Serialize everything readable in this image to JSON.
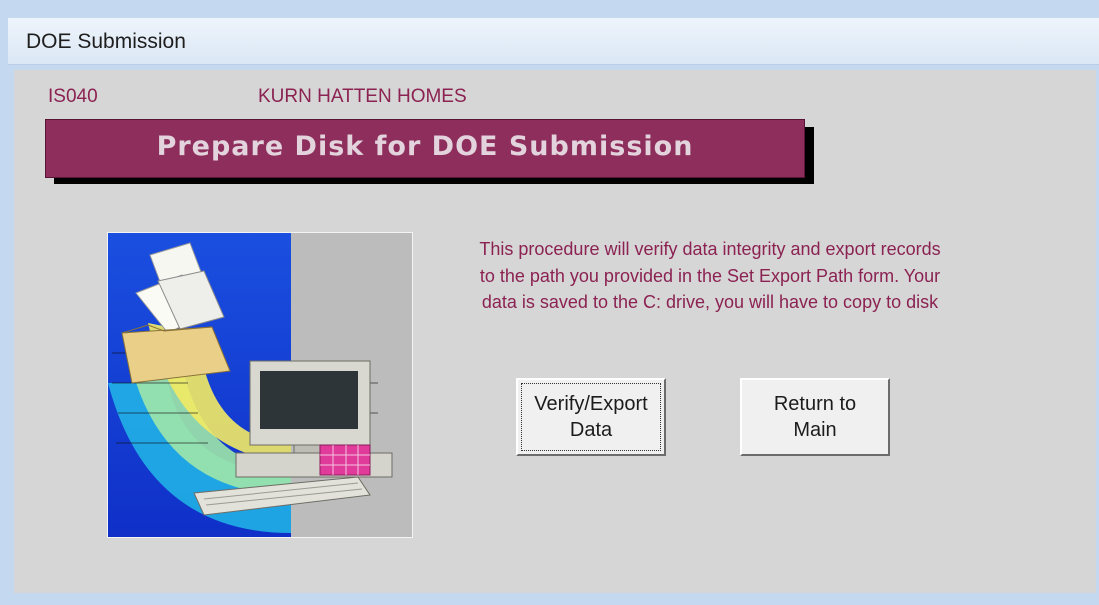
{
  "window": {
    "title": "DOE Submission"
  },
  "form": {
    "form_id": "IS040",
    "company_name": "KURN HATTEN HOMES",
    "banner_title": "Prepare Disk for DOE Submission",
    "description": "This procedure will verify data integrity and export records to the path you provided in the Set Export Path form.  Your data  is saved to the C: drive, you will have to copy to disk",
    "picture_icon": "computer-export-illustration"
  },
  "buttons": {
    "verify_export": "Verify/Export\nData",
    "return_main": "Return to\nMain"
  },
  "colors": {
    "banner_bg": "#8e2e5c",
    "banner_text": "#e2d3dc",
    "label_text": "#8b2252",
    "form_bg": "#d6d6d6"
  }
}
